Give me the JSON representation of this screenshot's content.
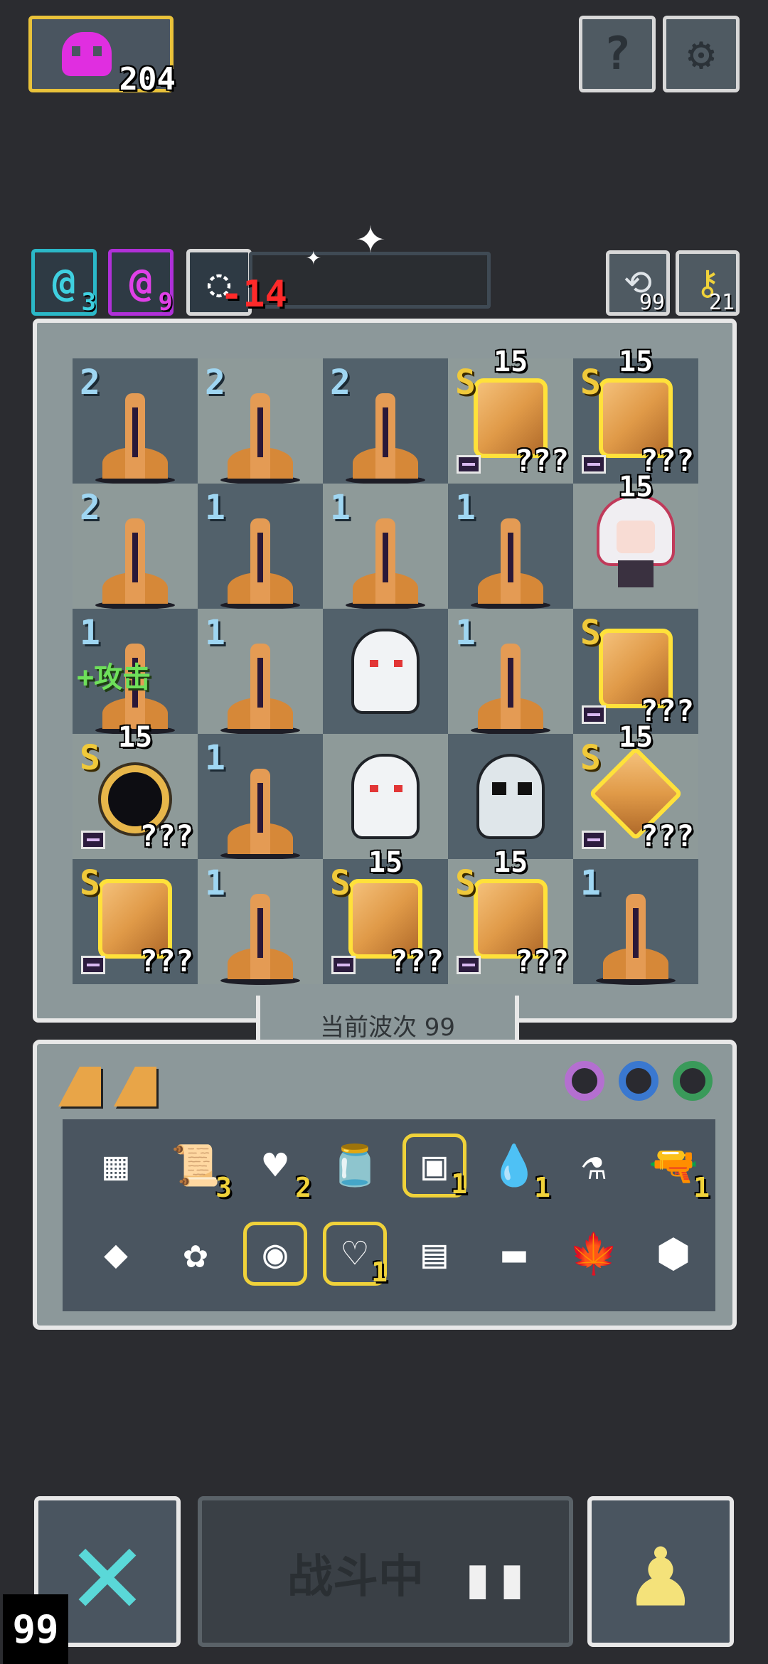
{
  "top": {
    "souls_count": "204",
    "help_label": "?",
    "settings_label": "⚙"
  },
  "status": {
    "cyan_count": "3",
    "magenta_count": "9",
    "damage": "-14",
    "refresh_count": "99",
    "key_count": "21"
  },
  "board": {
    "rows": [
      [
        {
          "type": "tree",
          "lvl": "2"
        },
        {
          "type": "tree",
          "lvl": "2"
        },
        {
          "type": "tree",
          "lvl": "2"
        },
        {
          "type": "crystal",
          "lvl": "S",
          "qty": "???",
          "over": "15"
        },
        {
          "type": "crystal",
          "lvl": "S",
          "qty": "???",
          "over": "15"
        }
      ],
      [
        {
          "type": "tree",
          "lvl": "2"
        },
        {
          "type": "tree",
          "lvl": "1"
        },
        {
          "type": "tree",
          "lvl": "1"
        },
        {
          "type": "tree",
          "lvl": "1"
        },
        {
          "type": "girl",
          "over": "15"
        }
      ],
      [
        {
          "type": "tree",
          "lvl": "1",
          "buff": "+攻击"
        },
        {
          "type": "tree",
          "lvl": "1"
        },
        {
          "type": "ghost"
        },
        {
          "type": "tree",
          "lvl": "1"
        },
        {
          "type": "crystal",
          "lvl": "S",
          "qty": "???"
        }
      ],
      [
        {
          "type": "hole",
          "lvl": "S",
          "qty": "???",
          "over": "15"
        },
        {
          "type": "tree",
          "lvl": "1"
        },
        {
          "type": "ghost"
        },
        {
          "type": "hooded"
        },
        {
          "type": "diamond",
          "lvl": "S",
          "qty": "???",
          "over": "15"
        }
      ],
      [
        {
          "type": "crystal",
          "lvl": "S",
          "qty": "???"
        },
        {
          "type": "tree",
          "lvl": "1"
        },
        {
          "type": "crystal",
          "lvl": "S",
          "qty": "???",
          "over": "15"
        },
        {
          "type": "crystal",
          "lvl": "S",
          "qty": "???",
          "over": "15"
        },
        {
          "type": "tree",
          "lvl": "1"
        }
      ]
    ]
  },
  "wave": {
    "label": "当前波次 99"
  },
  "inventory": {
    "items": [
      {
        "name": "chip-block-icon",
        "glyph": "▦",
        "count": ""
      },
      {
        "name": "scroll-icon",
        "glyph": "📜",
        "count": "3"
      },
      {
        "name": "heart-stone-icon",
        "glyph": "♥",
        "count": "2"
      },
      {
        "name": "green-jar-icon",
        "glyph": "🫙",
        "count": ""
      },
      {
        "name": "cpu-chip-icon",
        "glyph": "▣",
        "count": "1",
        "glow": true
      },
      {
        "name": "water-drop-icon",
        "glyph": "💧",
        "count": "1"
      },
      {
        "name": "potion-flask-icon",
        "glyph": "⚗",
        "count": ""
      },
      {
        "name": "pistol-icon",
        "glyph": "🔫",
        "count": "1"
      },
      {
        "name": "diamond-gem-icon",
        "glyph": "◆",
        "count": ""
      },
      {
        "name": "flower-icon",
        "glyph": "✿",
        "count": ""
      },
      {
        "name": "blue-orb-icon",
        "glyph": "◉",
        "count": "",
        "glow": true
      },
      {
        "name": "heart-shield-icon",
        "glyph": "♡",
        "count": "1",
        "glow": true
      },
      {
        "name": "camera-icon",
        "glyph": "▤",
        "count": ""
      },
      {
        "name": "wood-club-icon",
        "glyph": "▬",
        "count": ""
      },
      {
        "name": "maple-leaf-icon",
        "glyph": "🍁",
        "count": ""
      },
      {
        "name": "stone-icon",
        "glyph": "⬢",
        "count": ""
      }
    ]
  },
  "bottom": {
    "fight_label": "战斗中",
    "speed": "99"
  },
  "colors": {
    "background": "#2b2c30",
    "gold": "#e9c23a",
    "cyan": "#5ad8d8",
    "magenta": "#e02ee0"
  }
}
